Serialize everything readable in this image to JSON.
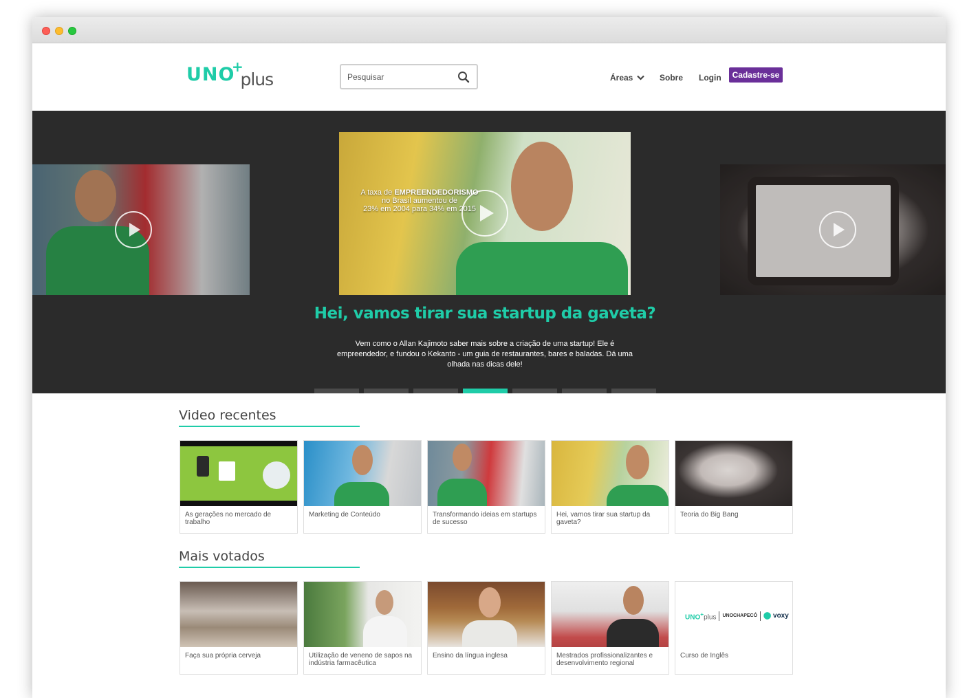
{
  "header": {
    "logo_main": "UNO",
    "logo_plus_sign": "+",
    "logo_sub": "plus",
    "search_placeholder": "Pesquisar",
    "nav_areas": "Áreas",
    "nav_sobre": "Sobre",
    "nav_login": "Login",
    "cta_label": "Cadastre-se"
  },
  "hero": {
    "video_overlay": {
      "line1_prefix": "A taxa de ",
      "line1_bold": "EMPREENDEDORISMO",
      "line2": "no Brasil aumentou de",
      "line3": "23% em 2004 para 34% em 2015"
    },
    "title": "Hei, vamos tirar sua startup da gaveta?",
    "description": "Vem como o Allan Kajimoto saber mais sobre a criação de uma startup! Ele é empreendedor, e fundou o Kekanto - um guia de restaurantes, bares e baladas. Dá uma olhada nas dicas dele!",
    "slides_total": 7,
    "active_slide": 4
  },
  "recent": {
    "title": "Video recentes",
    "items": [
      {
        "title": "As gerações no mercado de trabalho"
      },
      {
        "title": "Marketing de Conteúdo"
      },
      {
        "title": "Transformando ideias em startups de sucesso"
      },
      {
        "title": "Hei, vamos tirar sua startup da gaveta?"
      },
      {
        "title": "Teoria do Big Bang"
      }
    ]
  },
  "top_voted": {
    "title": "Mais votados",
    "items": [
      {
        "title": "Faça sua própria cerveja"
      },
      {
        "title": "Utilização de veneno de sapos na indústria farmacêutica"
      },
      {
        "title": "Ensino da língua inglesa"
      },
      {
        "title": "Mestrados profissionalizantes e desenvolvimento regional"
      },
      {
        "title": "Curso de Inglês"
      }
    ],
    "partner_logos": {
      "uno": "UNO",
      "plus": "plus",
      "unochapeco": "UNOCHAPECÓ",
      "voxy": "voxy"
    }
  },
  "colors": {
    "accent": "#1fcca8",
    "cta": "#6a2f99",
    "hero_bg": "#2b2b2b"
  }
}
